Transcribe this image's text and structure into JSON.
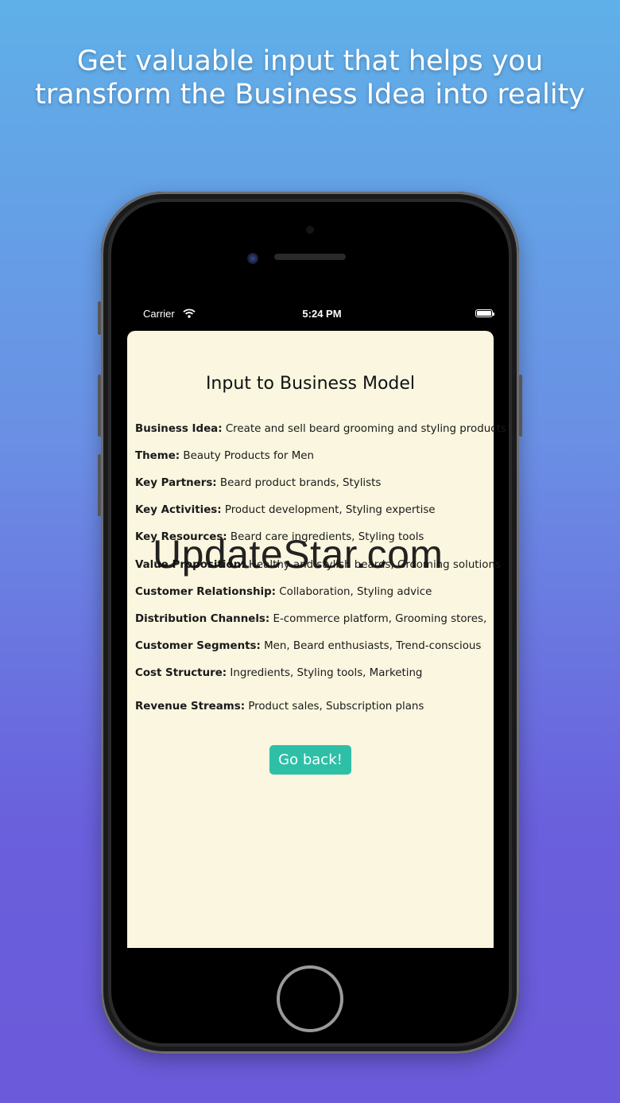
{
  "headline": "Get valuable input that helps you transform the Business Idea into reality",
  "status_bar": {
    "carrier": "Carrier",
    "wifi_icon": "wifi-icon",
    "time": "5:24 PM",
    "battery_icon": "battery-icon"
  },
  "card": {
    "title": "Input to Business Model",
    "rows": [
      {
        "key": "Business Idea:",
        "value": " Create and sell beard grooming and styling products"
      },
      {
        "key": "Theme:",
        "value": " Beauty Products for Men"
      },
      {
        "key": "Key Partners:",
        "value": " Beard product brands, Stylists"
      },
      {
        "key": "Key Activities:",
        "value": " Product development, Styling expertise"
      },
      {
        "key": "Key Resources:",
        "value": " Beard care ingredients, Styling tools"
      },
      {
        "key": "Value Proposition:",
        "value": " Healthy and stylish beards, Grooming solutions"
      },
      {
        "key": "Customer Relationship:",
        "value": " Collaboration, Styling advice"
      },
      {
        "key": "Distribution Channels:",
        "value": " E-commerce platform, Grooming stores,"
      },
      {
        "key": "Customer Segments:",
        "value": " Men, Beard enthusiasts, Trend-conscious"
      },
      {
        "key": "Cost Structure:",
        "value": " Ingredients, Styling tools, Marketing"
      },
      {
        "key": "Revenue Streams:",
        "value": " Product sales, Subscription plans"
      }
    ],
    "back_button": "Go back!"
  },
  "watermark": "UpdateStar.com",
  "colors": {
    "button": "#2ebfa7",
    "card_background": "#faf6df"
  }
}
